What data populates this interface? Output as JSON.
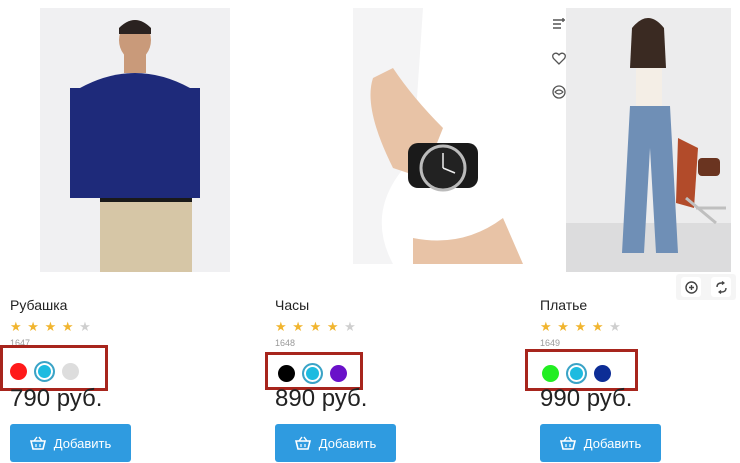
{
  "products": [
    {
      "title": "Рубашка",
      "rating_count": "1647",
      "stars": [
        "★",
        "★",
        "★",
        "★",
        "★"
      ],
      "rating": 4,
      "colors": [
        "#ff1a1a",
        "#1dbbe0",
        "#dddddd"
      ],
      "price": "790 руб.",
      "add_label": "Добавить"
    },
    {
      "title": "Часы",
      "rating_count": "1648",
      "stars": [
        "★",
        "★",
        "★",
        "★",
        "★"
      ],
      "rating": 4,
      "colors": [
        "#000000",
        "#1dbbe0",
        "#6a11c9"
      ],
      "price": "890 руб.",
      "add_label": "Добавить"
    },
    {
      "title": "Платье",
      "rating_count": "1649",
      "stars": [
        "★",
        "★",
        "★",
        "★",
        "★"
      ],
      "rating": 4,
      "colors": [
        "#22ee22",
        "#1dbbe0",
        "#0d2d96"
      ],
      "price": "990 руб.",
      "add_label": "Добавить"
    }
  ],
  "icons": {
    "compare": "compare-icon",
    "favorite": "heart-icon",
    "quick_view": "eye-icon",
    "zoom": "zoom-icon",
    "rotate": "rotate-icon",
    "basket": "basket-icon"
  },
  "accent_color": "#2f9be0",
  "highlight_color": "#a7251d"
}
